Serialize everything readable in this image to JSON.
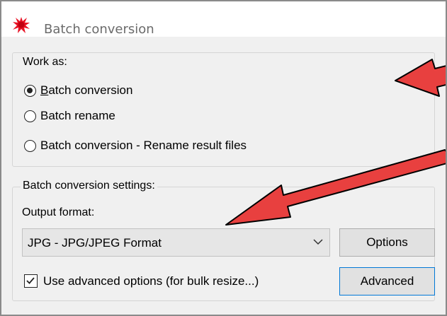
{
  "window": {
    "title": "Batch conversion",
    "app_icon": "red-splat-icon"
  },
  "work_as": {
    "legend": "Work as:",
    "options": [
      {
        "label": "Batch conversion",
        "selected": true
      },
      {
        "label": "Batch rename",
        "selected": false
      },
      {
        "label": "Batch conversion - Rename result files",
        "selected": false
      }
    ]
  },
  "settings": {
    "legend": "Batch conversion settings:",
    "output_format_label": "Output format:",
    "output_format_value": "JPG - JPG/JPEG Format",
    "options_button": "Options",
    "advanced_checkbox": {
      "label": "Use advanced options (for bulk resize...)",
      "checked": true
    },
    "advanced_button": "Advanced"
  },
  "colors": {
    "arrow_fill": "#e8403f",
    "arrow_outline": "#000000",
    "default_button_border": "#0078d7"
  }
}
